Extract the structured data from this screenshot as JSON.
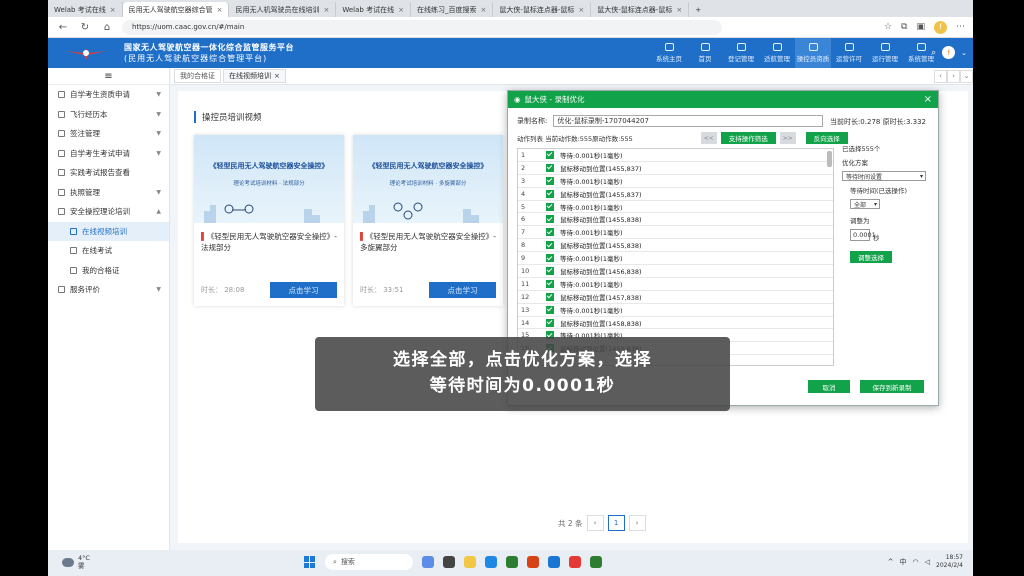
{
  "browser": {
    "tabs": [
      {
        "label": "Welab 考试在线"
      },
      {
        "label": "民用无人驾驶航空器综合管"
      },
      {
        "label": "民用无人机驾驶员在线培训"
      },
      {
        "label": "Welab 考试在线"
      },
      {
        "label": "在线练习_百度搜索"
      },
      {
        "label": "鼠大侠-鼠标连点器-鼠标"
      },
      {
        "label": "鼠大侠-鼠标连点器-鼠标"
      }
    ],
    "url": "https://uom.caac.gov.cn/#/main"
  },
  "site": {
    "title_line1": "国家无人驾驶航空器一体化综合监管服务平台",
    "title_line2": "(民用无人驾驶航空器综合管理平台)",
    "nav": [
      {
        "label": "系统主页"
      },
      {
        "label": "首页"
      },
      {
        "label": "登记管理"
      },
      {
        "label": "适航管理"
      },
      {
        "label": "操控员资质"
      },
      {
        "label": "运营许可"
      },
      {
        "label": "运行管理"
      },
      {
        "label": "系统管理"
      }
    ],
    "user_initial": "f"
  },
  "sidebar": {
    "menu_icon": "≡",
    "items": [
      {
        "label": "自学考生资质申请"
      },
      {
        "label": "飞行经历本"
      },
      {
        "label": "签注管理"
      },
      {
        "label": "自学考生考试申请"
      },
      {
        "label": "实践考试报告查看"
      },
      {
        "label": "执照管理"
      },
      {
        "label": "安全操控理论培训"
      },
      {
        "label": "在线视频培训"
      },
      {
        "label": "在线考试"
      },
      {
        "label": "我的合格证"
      },
      {
        "label": "服务评价"
      }
    ]
  },
  "content_tabs": [
    {
      "label": "我的合格证"
    },
    {
      "label": "在线视频培训"
    }
  ],
  "main": {
    "title": "操控员培训视频",
    "cards": [
      {
        "image_title": "《轻型民用无人驾驶航空器安全操控》",
        "image_subtitle": "理论考试培训材料 · 法规部分",
        "title": "《轻型民用无人驾驶航空器安全操控》- 法规部分",
        "duration": "时长：  28:08",
        "button": "点击学习"
      },
      {
        "image_title": "《轻型民用无人驾驶航空器安全操控》",
        "image_subtitle": "理论考试培训材料 · 多旋翼部分",
        "title": "《轻型民用无人驾驶航空器安全操控》- 多旋翼部分",
        "duration": "时长：  33:51",
        "button": "点击学习"
      }
    ],
    "pager": {
      "total": "共 2 条",
      "current": "1",
      "prev": "‹",
      "next": "›"
    }
  },
  "dialog": {
    "title": "鼠大侠 - 录制优化",
    "record_label": "录制名称:",
    "record_name": "优化-鼠标录制-1707044207",
    "current_duration": "当前时长:0.278",
    "original_duration": "原时长:3.332",
    "action_summary": "动作列表  当前动作数:555原动作数:555",
    "btn_disabled1": "<<",
    "btn_filter": "支持操作筛选",
    "btn_disabled2": ">>",
    "btn_reverse": "反向选择",
    "rows": [
      {
        "n": "1",
        "text": "等待:0.001秒(1毫秒)"
      },
      {
        "n": "2",
        "text": "鼠标移动到位置(1455,837)"
      },
      {
        "n": "3",
        "text": "等待:0.001秒(1毫秒)"
      },
      {
        "n": "4",
        "text": "鼠标移动到位置(1455,837)"
      },
      {
        "n": "5",
        "text": "等待:0.001秒(1毫秒)"
      },
      {
        "n": "6",
        "text": "鼠标移动到位置(1455,838)"
      },
      {
        "n": "7",
        "text": "等待:0.001秒(1毫秒)"
      },
      {
        "n": "8",
        "text": "鼠标移动到位置(1455,838)"
      },
      {
        "n": "9",
        "text": "等待:0.001秒(1毫秒)"
      },
      {
        "n": "10",
        "text": "鼠标移动到位置(1456,838)"
      },
      {
        "n": "11",
        "text": "等待:0.001秒(1毫秒)"
      },
      {
        "n": "12",
        "text": "鼠标移动到位置(1457,838)"
      },
      {
        "n": "13",
        "text": "等待:0.001秒(1毫秒)"
      },
      {
        "n": "14",
        "text": "鼠标移动到位置(1458,838)"
      },
      {
        "n": "15",
        "text": "等待:0.001秒(1毫秒)"
      },
      {
        "n": "16",
        "text": "鼠标移动到位置(1459,838)"
      }
    ],
    "selected_info": "已选择555个",
    "opt_label": "优化方案",
    "opt_select": "等待时间设置",
    "wait_label": "等待时间(已选操作)",
    "wait_select": "全部",
    "adjust_label": "调整为",
    "adjust_value": "0.0001",
    "adjust_unit": "秒",
    "adjust_btn": "调整选择",
    "cancel": "取消",
    "save": "保存到新录制"
  },
  "caption": {
    "line1": "选择全部，点击优化方案，选择",
    "line2": "等待时间为0.0001秒"
  },
  "taskbar": {
    "temp": "4°C",
    "weather": "雾",
    "search": "搜索",
    "lang": "中",
    "time": "18:57",
    "date": "2024/2/4"
  }
}
